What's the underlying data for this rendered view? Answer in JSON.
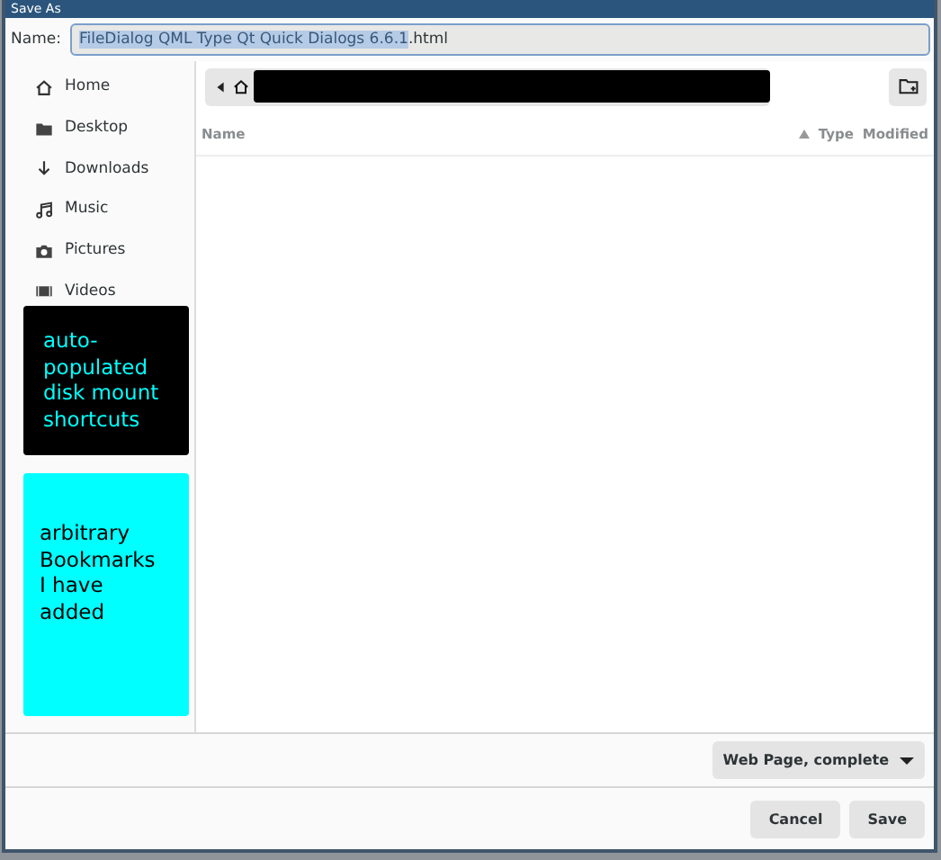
{
  "window": {
    "title": "Save As"
  },
  "name_field": {
    "label": "Name:",
    "selected_text": "FileDialog QML Type Qt Quick Dialogs 6.6.1",
    "rest_text": ".html"
  },
  "sidebar": {
    "items": [
      {
        "label": "Home"
      },
      {
        "label": "Desktop"
      },
      {
        "label": "Downloads"
      },
      {
        "label": "Music"
      },
      {
        "label": "Pictures"
      },
      {
        "label": "Videos"
      }
    ],
    "annotations": [
      {
        "kind": "dark",
        "text": "auto-populated disk mount shortcuts"
      },
      {
        "kind": "light",
        "text": "arbitrary Bookmarks I have added"
      }
    ]
  },
  "file_list": {
    "columns": [
      "Name",
      "Type",
      "Modified"
    ]
  },
  "file_type": {
    "value": "Web Page, complete"
  },
  "buttons": [
    "Cancel",
    "Save"
  ]
}
